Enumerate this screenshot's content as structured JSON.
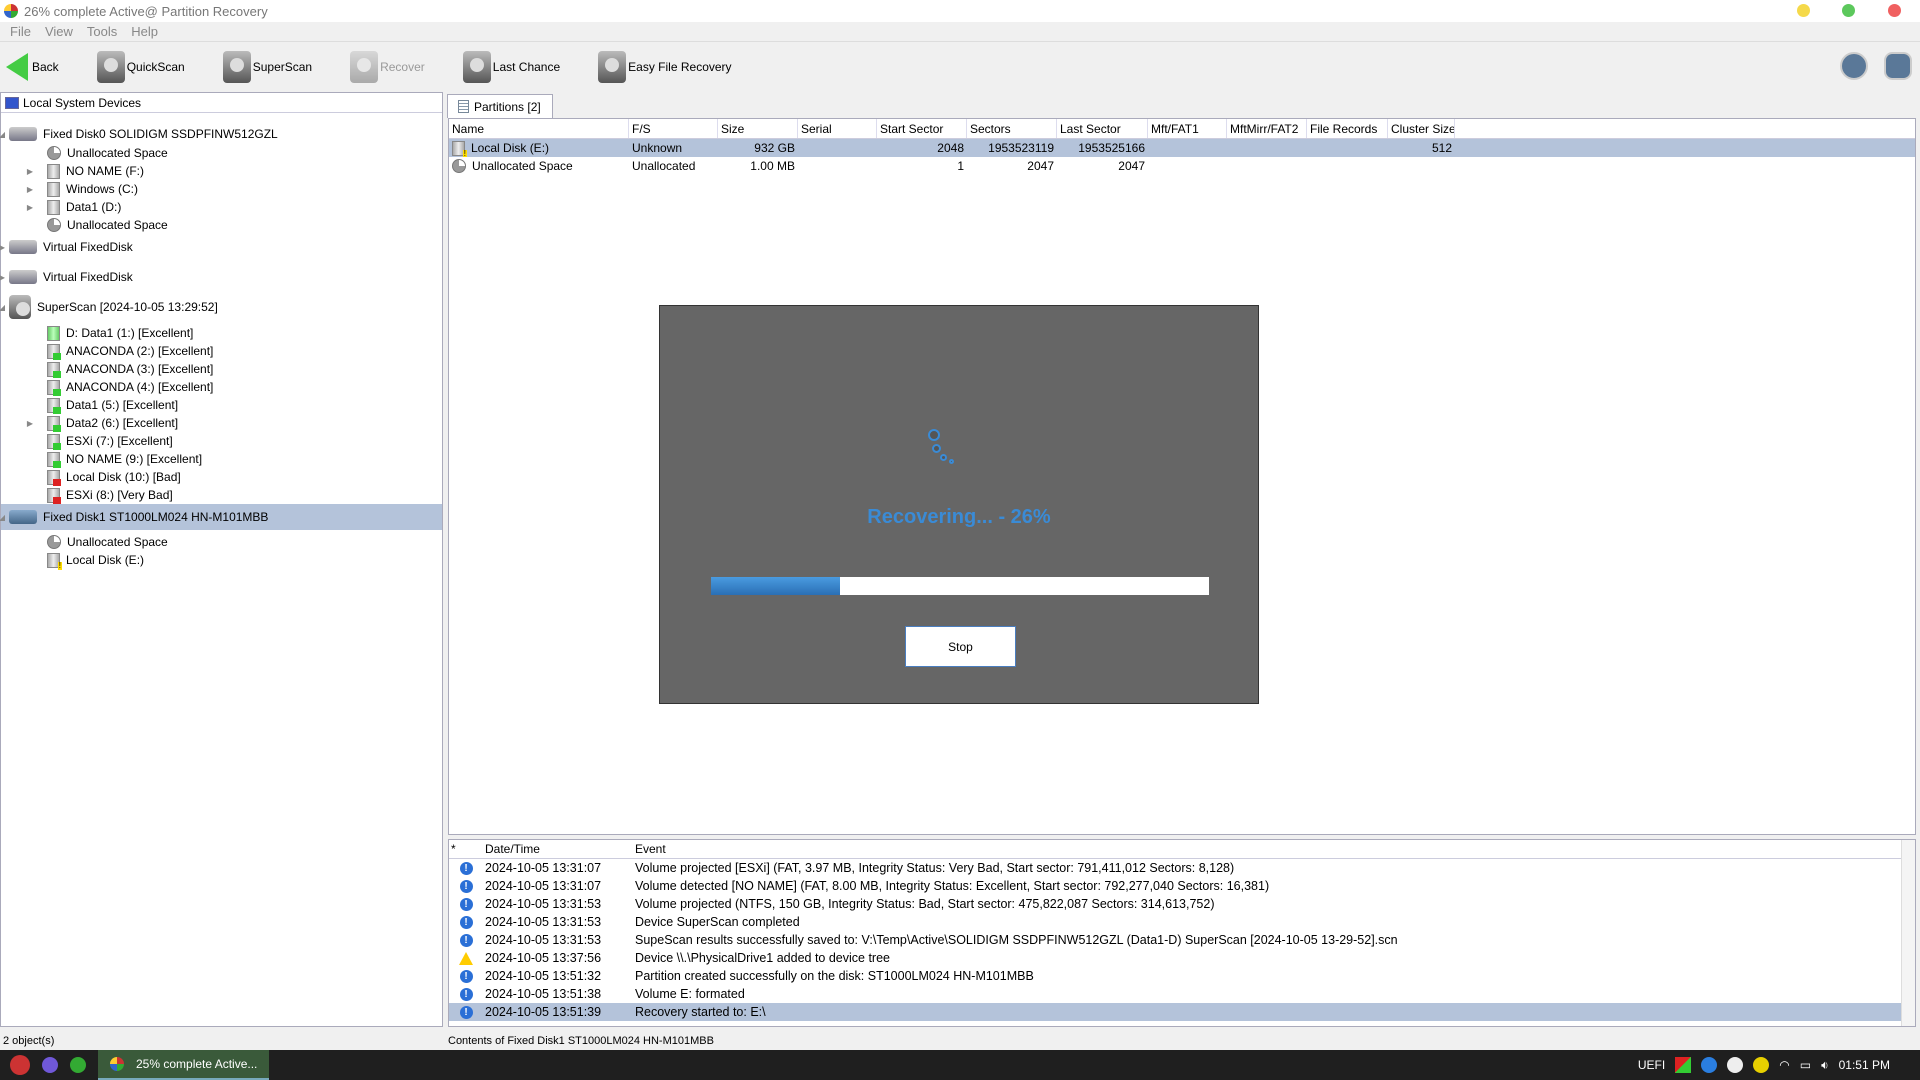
{
  "window": {
    "title": "26% complete Active@ Partition Recovery"
  },
  "menu": [
    "File",
    "View",
    "Tools",
    "Help"
  ],
  "toolbar": {
    "back": "Back",
    "quickscan": "QuickScan",
    "superscan": "SuperScan",
    "recover": "Recover",
    "last_chance": "Last Chance",
    "easy_file_recovery": "Easy File Recovery"
  },
  "tree": {
    "header": "Local System Devices",
    "nodes": [
      {
        "label": "Fixed Disk0 SOLIDIGM SSDPFINW512GZL"
      },
      {
        "label": "Unallocated Space"
      },
      {
        "label": "NO NAME (F:)"
      },
      {
        "label": "Windows (C:)"
      },
      {
        "label": "Data1 (D:)"
      },
      {
        "label": "Unallocated Space"
      },
      {
        "label": "Virtual FixedDisk"
      },
      {
        "label": "Virtual FixedDisk"
      },
      {
        "label": "SuperScan [2024-10-05 13:29:52]"
      },
      {
        "label": "D: Data1 (1:) [Excellent]"
      },
      {
        "label": "ANACONDA (2:) [Excellent]"
      },
      {
        "label": "ANACONDA (3:) [Excellent]"
      },
      {
        "label": "ANACONDA (4:) [Excellent]"
      },
      {
        "label": "Data1 (5:) [Excellent]"
      },
      {
        "label": "Data2 (6:) [Excellent]"
      },
      {
        "label": "ESXi (7:) [Excellent]"
      },
      {
        "label": "NO NAME (9:) [Excellent]"
      },
      {
        "label": "Local Disk (10:) [Bad]"
      },
      {
        "label": "ESXi (8:) [Very Bad]"
      },
      {
        "label": "Fixed Disk1 ST1000LM024 HN-M101MBB"
      },
      {
        "label": "Unallocated Space"
      },
      {
        "label": "Local Disk (E:)"
      }
    ]
  },
  "tab": {
    "label": "Partitions [2]"
  },
  "grid": {
    "columns": [
      "Name",
      "F/S",
      "Size",
      "Serial",
      "Start Sector",
      "Sectors",
      "Last Sector",
      "Mft/FAT1",
      "MftMirr/FAT2",
      "File Records",
      "Cluster Size"
    ],
    "rows": [
      [
        "Local Disk (E:)",
        "Unknown",
        "932 GB",
        "",
        "2048",
        "1953523119",
        "1953525166",
        "",
        "",
        "",
        "512"
      ],
      [
        "Unallocated Space",
        "Unallocated",
        "1.00 MB",
        "",
        "1",
        "2047",
        "2047",
        "",
        "",
        "",
        ""
      ]
    ]
  },
  "dialog": {
    "status": "Recovering... - 26%",
    "progress_percent": 26,
    "stop_label": "Stop"
  },
  "log": {
    "columns": [
      "*",
      "Date/Time",
      "Event"
    ],
    "rows": [
      {
        "type": "info",
        "time": "2024-10-05 13:31:07",
        "event": "Volume projected [ESXi] (FAT, 3.97 MB, Integrity Status: Very Bad, Start sector: 791,411,012 Sectors: 8,128)"
      },
      {
        "type": "info",
        "time": "2024-10-05 13:31:07",
        "event": "Volume detected [NO NAME] (FAT, 8.00 MB, Integrity Status: Excellent, Start sector: 792,277,040 Sectors: 16,381)"
      },
      {
        "type": "info",
        "time": "2024-10-05 13:31:53",
        "event": "Volume projected (NTFS, 150 GB, Integrity Status: Bad, Start sector: 475,822,087 Sectors: 314,613,752)"
      },
      {
        "type": "info",
        "time": "2024-10-05 13:31:53",
        "event": "Device SuperScan completed"
      },
      {
        "type": "info",
        "time": "2024-10-05 13:31:53",
        "event": "SupeScan results successfully saved to: V:\\Temp\\Active\\SOLIDIGM SSDPFINW512GZL (Data1-D) SuperScan [2024-10-05 13-29-52].scn"
      },
      {
        "type": "warning",
        "time": "2024-10-05 13:37:56",
        "event": "Device \\\\.\\PhysicalDrive1 added to device tree"
      },
      {
        "type": "info",
        "time": "2024-10-05 13:51:32",
        "event": "Partition created successfully on the disk: ST1000LM024 HN-M101MBB"
      },
      {
        "type": "info",
        "time": "2024-10-05 13:51:38",
        "event": "Volume E: formated"
      },
      {
        "type": "info",
        "time": "2024-10-05 13:51:39",
        "event": "Recovery started to: E:\\"
      }
    ]
  },
  "status": {
    "left": "2 object(s)",
    "right": "Contents of Fixed Disk1 ST1000LM024 HN-M101MBB"
  },
  "taskbar": {
    "task": "25% complete Active...",
    "uefi": "UEFI",
    "clock": "01:51 PM"
  },
  "colors": {
    "accent": "#3a8bd6",
    "selection": "#b4c3da",
    "dialog_bg": "#666666"
  }
}
